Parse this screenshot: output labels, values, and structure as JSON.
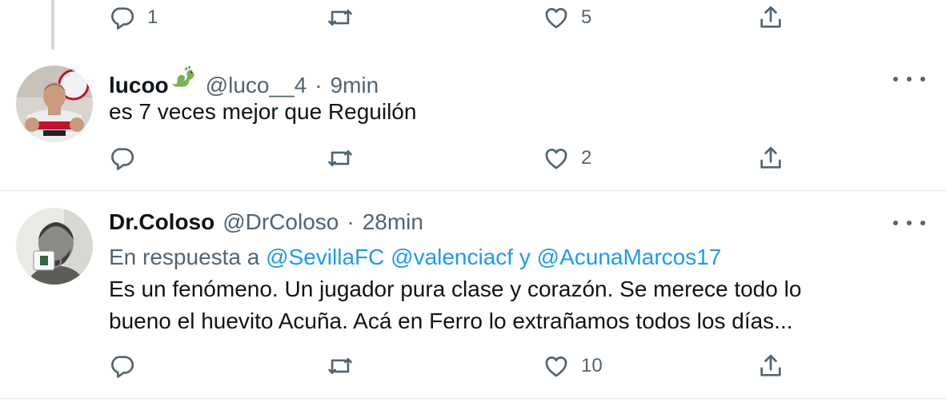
{
  "prev_tweet": {
    "reply_count": "1",
    "retweet_count": "",
    "like_count": "5"
  },
  "tweets": [
    {
      "display_name": "lucoo",
      "name_emoji": "dragon-emoji",
      "handle": "@luco__4",
      "separator": "·",
      "time": "9min",
      "text": "es 7 veces mejor que Reguilón",
      "reply_count": "",
      "retweet_count": "",
      "like_count": "2",
      "avatar_colors": {
        "shirt": "#e8e8e8",
        "accent": "#c8102e"
      }
    },
    {
      "display_name": "Dr.Coloso",
      "handle": "@DrColoso",
      "separator": "·",
      "time": "28min",
      "reply_prefix": "En respuesta a",
      "mentions": [
        "@SevillaFC",
        "@valenciacf",
        "@AcunaMarcos17"
      ],
      "mention_joiner": "y",
      "text_line1": "Es un fenómeno. Un jugador pura clase y corazón. Se merece todo lo",
      "text_line2": "bueno el huevito Acuña. Acá en Ferro lo extrañamos todos los días...",
      "reply_count": "",
      "retweet_count": "",
      "like_count": "10"
    }
  ],
  "colors": {
    "text_primary": "#0f1419",
    "text_secondary": "#536471",
    "link": "#1d9bf0",
    "divider": "#e6ecf0"
  }
}
